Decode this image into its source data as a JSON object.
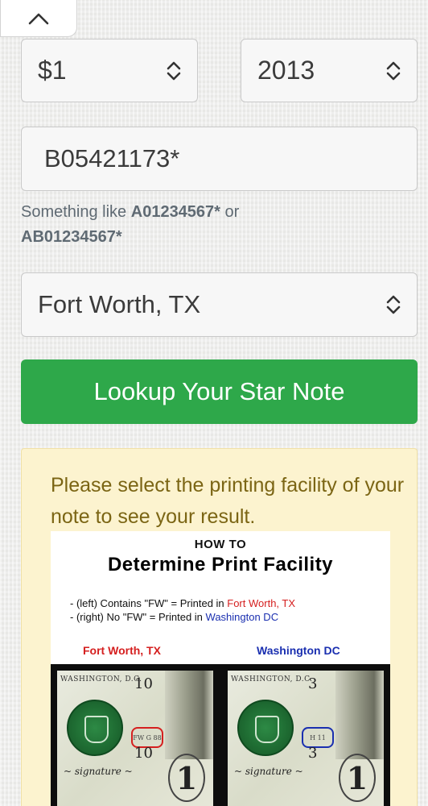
{
  "denomination": {
    "value": "$1"
  },
  "year": {
    "value": "2013"
  },
  "serial": {
    "value": "B05421173*"
  },
  "hint": {
    "prefix": "Something like ",
    "example1": "A01234567*",
    "middle": " or",
    "example2": "AB01234567*"
  },
  "facility": {
    "value": "Fort Worth, TX"
  },
  "lookup_button": {
    "label": "Lookup Your Star Note"
  },
  "notice": {
    "message": "Please select the printing facility of your note to see your result."
  },
  "guide": {
    "how_to": "HOW TO",
    "title": "Determine Print Facility",
    "line1_prefix": "- (left) Contains \"FW\" = Printed in ",
    "line1_place": "Fort Worth, TX",
    "line2_prefix": "- (right) No \"FW\" = Printed in ",
    "line2_place": "Washington DC",
    "label_left": "Fort Worth, TX",
    "label_right": "Washington DC",
    "note_left": {
      "city": "WASHINGTON, D.C.",
      "number": "10",
      "plate": "FW G 88",
      "number_low": "10"
    },
    "note_right": {
      "city": "WASHINGTON, D.C.",
      "number": "3",
      "plate": "H 11",
      "number_low": "3"
    }
  },
  "colors": {
    "button": "#2ea84a",
    "notice_bg": "#fcf3cf",
    "notice_text": "#7b6514",
    "fw_red": "#d51f1f",
    "dc_blue": "#1a2fb0"
  },
  "icons": {
    "collapse": "chevron-up-icon",
    "select": "up-down-chevron-icon"
  }
}
